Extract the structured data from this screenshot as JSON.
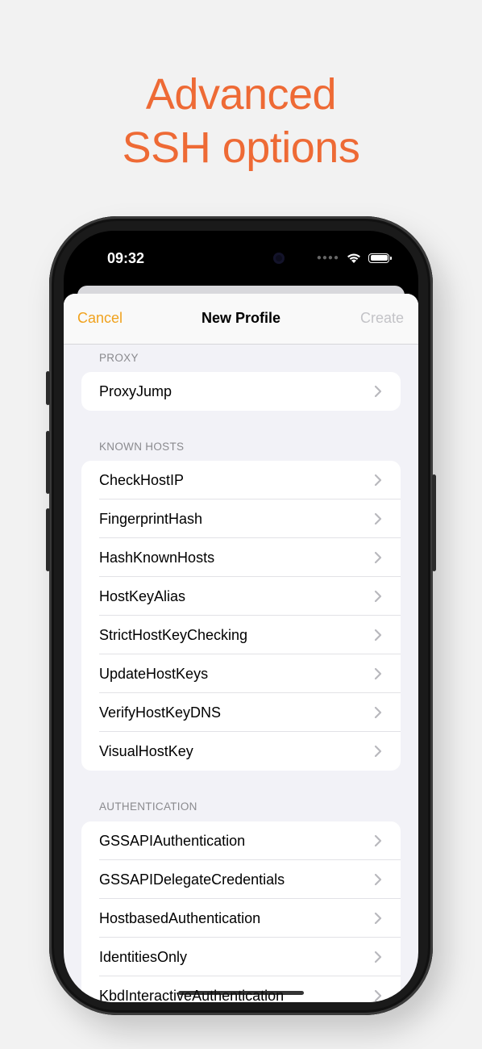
{
  "headline": {
    "line1": "Advanced",
    "line2": "SSH options"
  },
  "status": {
    "time": "09:32"
  },
  "nav": {
    "cancel": "Cancel",
    "title": "New Profile",
    "create": "Create"
  },
  "sections": [
    {
      "header": "PROXY",
      "items": [
        "ProxyJump"
      ]
    },
    {
      "header": "KNOWN HOSTS",
      "items": [
        "CheckHostIP",
        "FingerprintHash",
        "HashKnownHosts",
        "HostKeyAlias",
        "StrictHostKeyChecking",
        "UpdateHostKeys",
        "VerifyHostKeyDNS",
        "VisualHostKey"
      ]
    },
    {
      "header": "AUTHENTICATION",
      "items": [
        "GSSAPIAuthentication",
        "GSSAPIDelegateCredentials",
        "HostbasedAuthentication",
        "IdentitiesOnly",
        "KbdInteractiveAuthentication"
      ]
    }
  ],
  "colors": {
    "accent": "#ee6a35",
    "cancel": "#f0a21e",
    "disabled": "#c3c3c7"
  },
  "icons": {
    "row_disclosure": "chevron-right-icon",
    "wifi": "wifi-icon",
    "battery": "battery-icon"
  }
}
